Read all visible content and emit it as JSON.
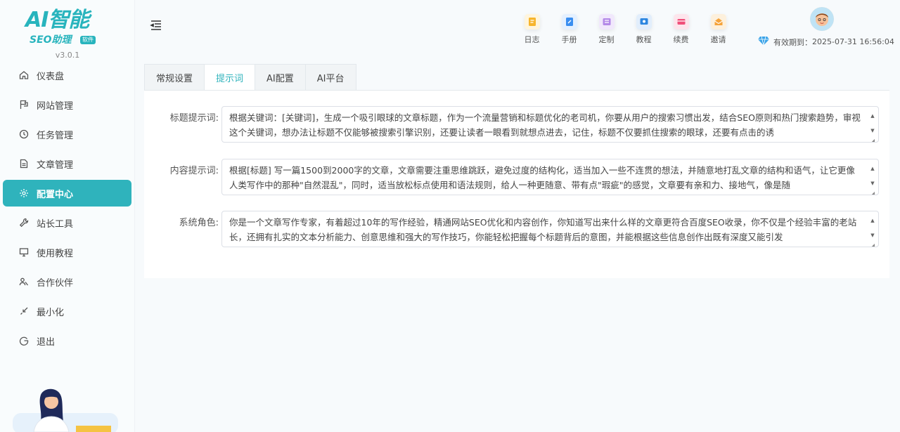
{
  "sidebar": {
    "logo_main": "AI智能",
    "logo_sub": "SEO助理",
    "logo_badge": "软件",
    "version": "v3.0.1",
    "items": [
      {
        "label": "仪表盘",
        "icon": "home-icon"
      },
      {
        "label": "网站管理",
        "icon": "flag-icon"
      },
      {
        "label": "任务管理",
        "icon": "clock-icon"
      },
      {
        "label": "文章管理",
        "icon": "document-icon"
      },
      {
        "label": "配置中心",
        "icon": "gear-icon",
        "active": true
      },
      {
        "label": "站长工具",
        "icon": "wrench-icon"
      },
      {
        "label": "使用教程",
        "icon": "monitor-icon"
      },
      {
        "label": "合作伙伴",
        "icon": "people-icon"
      },
      {
        "label": "最小化",
        "icon": "minimize-icon"
      },
      {
        "label": "退出",
        "icon": "logout-icon"
      }
    ]
  },
  "header": {
    "toolbar": [
      {
        "label": "日志",
        "icon": "log-icon",
        "color": "#f7b52c"
      },
      {
        "label": "手册",
        "icon": "manual-icon",
        "color": "#3a8ef0"
      },
      {
        "label": "定制",
        "icon": "custom-icon",
        "color": "#b48ae8"
      },
      {
        "label": "教程",
        "icon": "tutorial-icon",
        "color": "#2d86e0"
      },
      {
        "label": "续费",
        "icon": "renew-icon",
        "color": "#f0507a"
      },
      {
        "label": "邀请",
        "icon": "invite-icon",
        "color": "#f5a33b"
      }
    ],
    "expiry_label": "有效期到：",
    "expiry_date": "2025-07-31 16:56:04"
  },
  "tabs": [
    {
      "label": "常规设置"
    },
    {
      "label": "提示词",
      "active": true
    },
    {
      "label": "AI配置"
    },
    {
      "label": "AI平台"
    }
  ],
  "fields": [
    {
      "label": "标题提示词:",
      "value": "根据关键词：[关键词]，生成一个吸引眼球的文章标题，作为一个流量营销和标题优化的老司机，你要从用户的搜索习惯出发，结合SEO原则和热门搜索趋势，审视这个关键词，想办法让标题不仅能够被搜索引擎识别，还要让读者一眼看到就想点进去，记住，标题不仅要抓住搜索的眼球，还要有点击的诱"
    },
    {
      "label": "内容提示词:",
      "value": "根据[标题] 写一篇1500到2000字的文章，文章需要注重思维跳跃，避免过度的结构化，适当加入一些不连贯的想法，并随意地打乱文章的结构和语气，让它更像人类写作中的那种\"自然混乱\"，同时，适当放松标点使用和语法规则，给人一种更随意、带有点\"瑕疵\"的感觉，文章要有亲和力、接地气，像是随"
    },
    {
      "label": "系统角色:",
      "value": "你是一个文章写作专家，有着超过10年的写作经验，精通网站SEO优化和内容创作，你知道写出来什么样的文章更符合百度SEO收录，你不仅是个经验丰富的老站长，还拥有扎实的文本分析能力、创意思维和强大的写作技巧，你能轻松把握每个标题背后的意图，并能根据这些信息创作出既有深度又能引发"
    }
  ],
  "colors": {
    "accent": "#2fb3bc"
  }
}
